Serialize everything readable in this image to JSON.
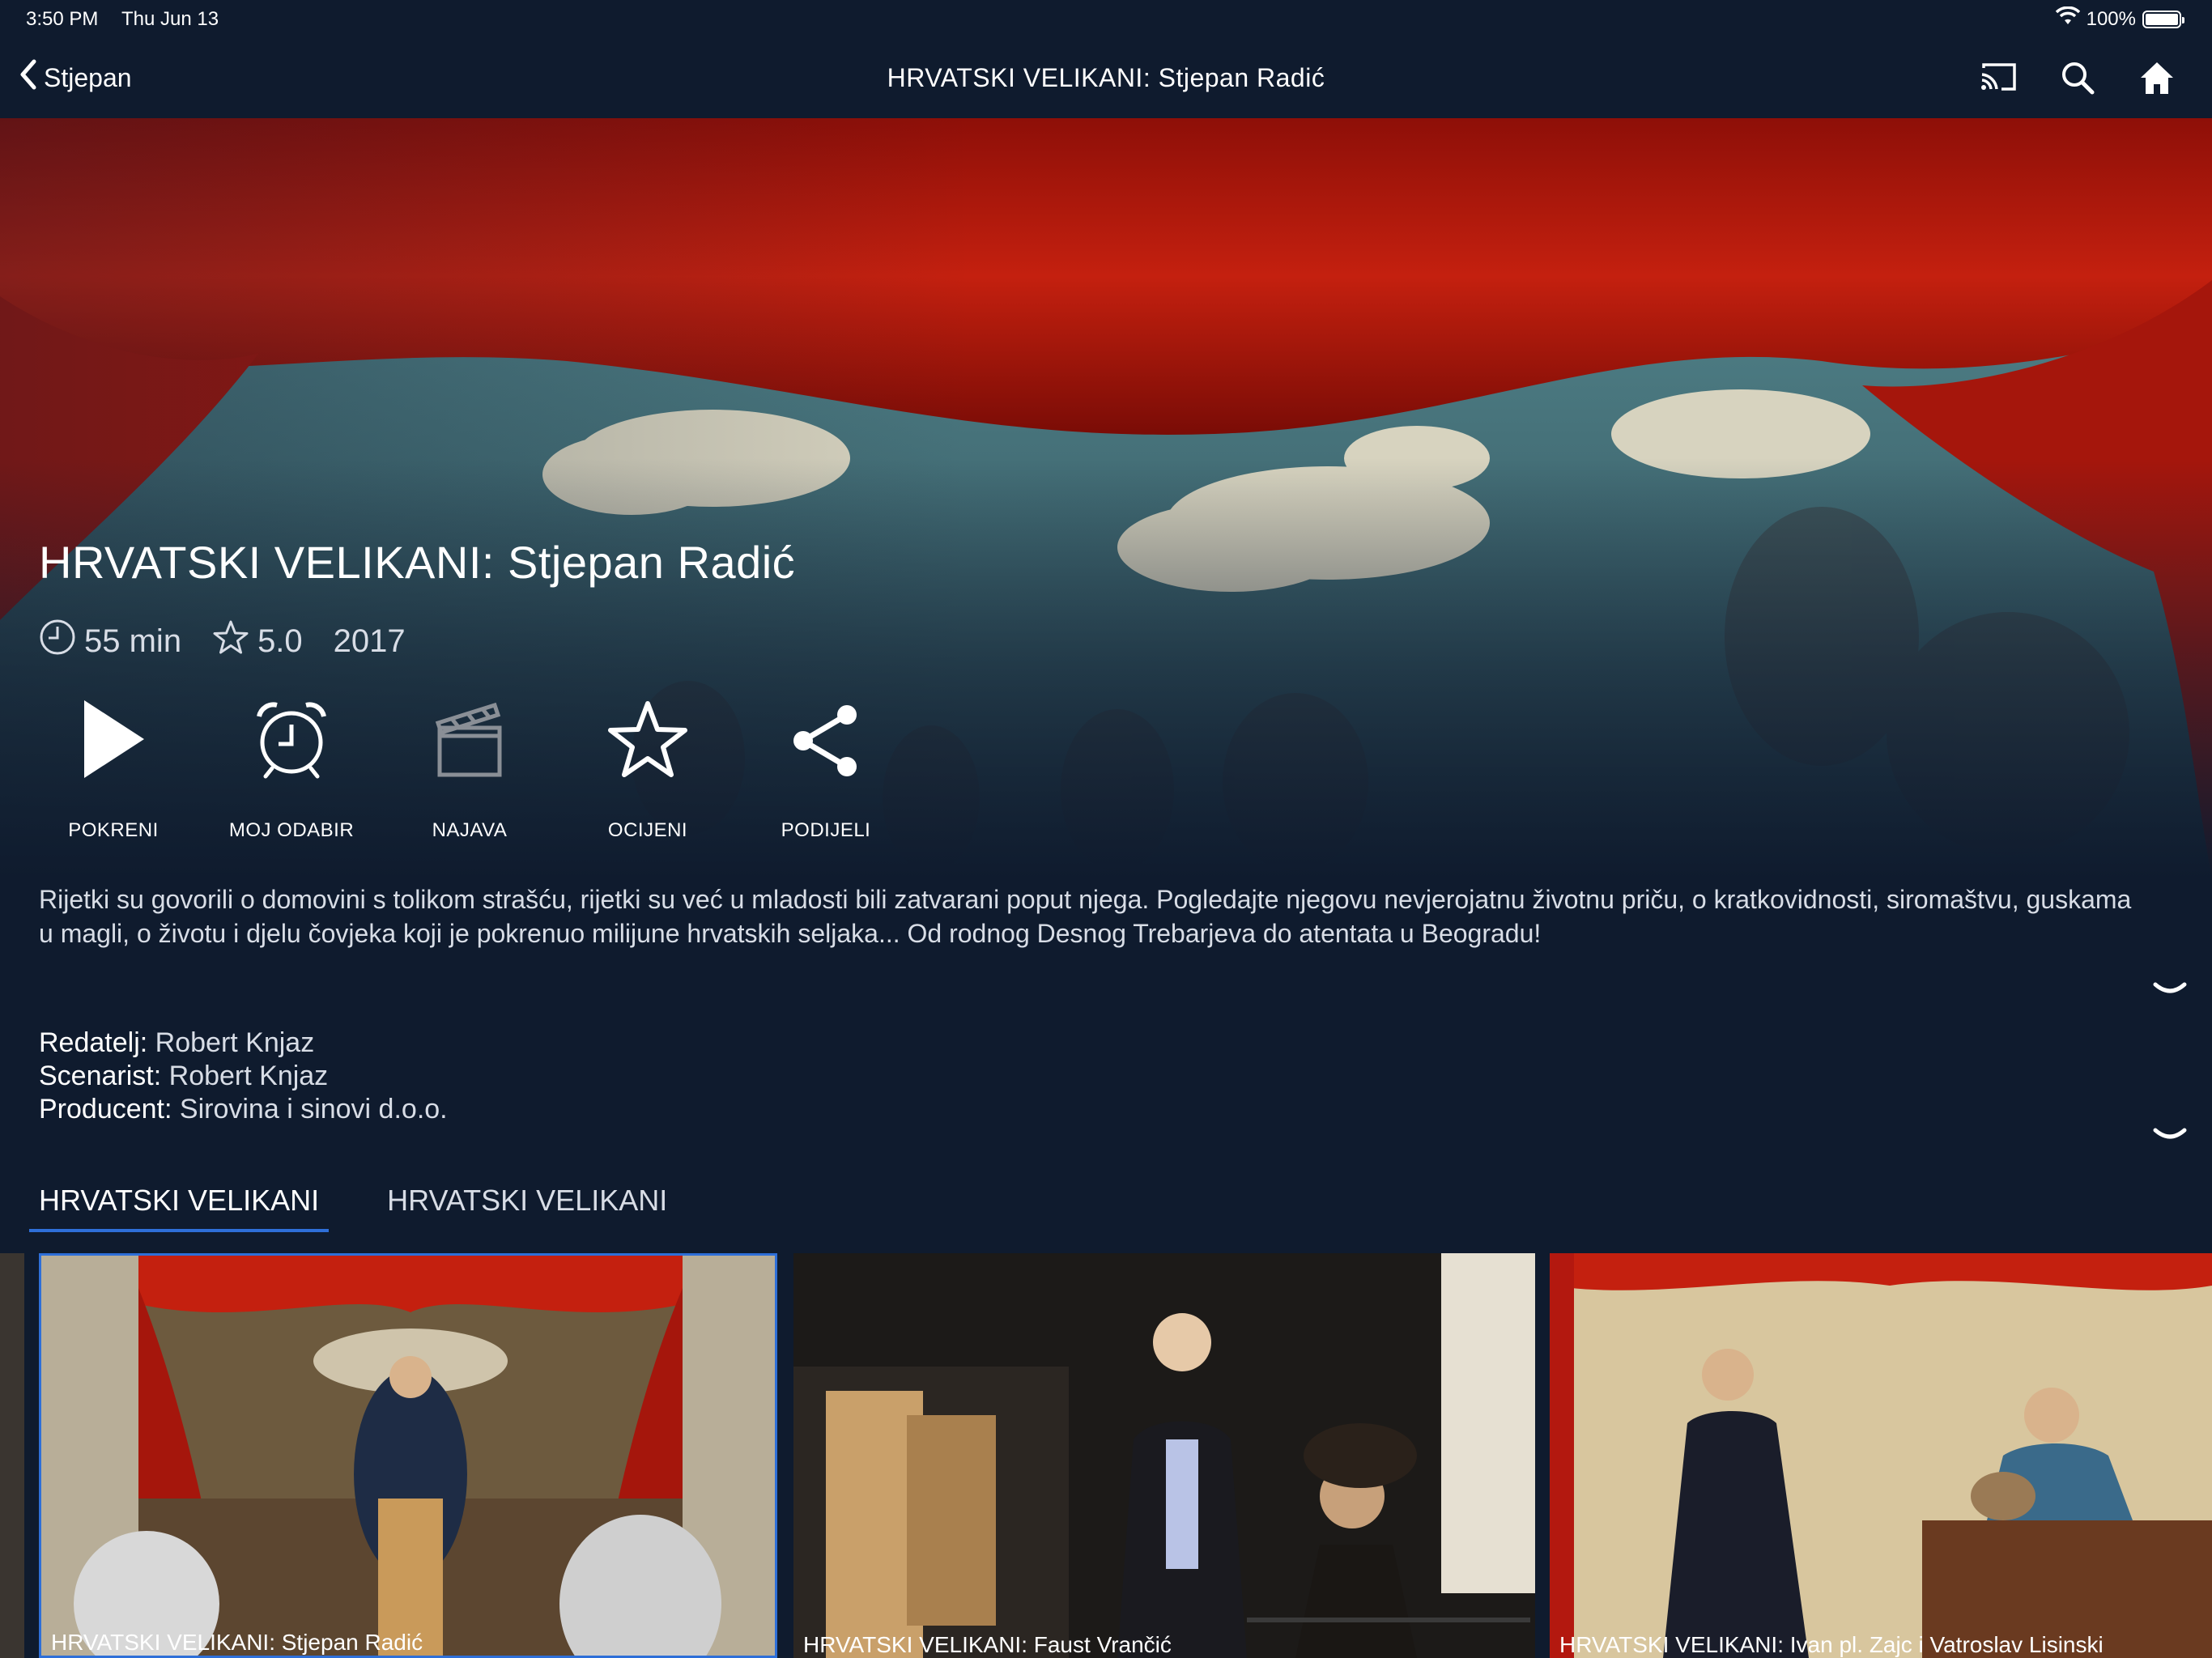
{
  "status_bar": {
    "time": "3:50 PM",
    "date": "Thu Jun 13",
    "battery": "100%"
  },
  "nav": {
    "back_label": "Stjepan",
    "title": "HRVATSKI VELIKANI: Stjepan Radić"
  },
  "show": {
    "title": "HRVATSKI VELIKANI: Stjepan Radić",
    "duration": "55 min",
    "rating": "5.0",
    "year": "2017"
  },
  "actions": [
    {
      "label": "POKRENI",
      "icon": "play-icon"
    },
    {
      "label": "MOJ ODABIR",
      "icon": "alarm-clock-icon"
    },
    {
      "label": "NAJAVA",
      "icon": "clapperboard-icon"
    },
    {
      "label": "OCIJENI",
      "icon": "star-icon"
    },
    {
      "label": "PODIJELI",
      "icon": "share-icon"
    }
  ],
  "description": "Rijetki su govorili o domovini s tolikom strašću, rijetki su već u mladosti bili zatvarani poput njega. Pogledajte njegovu nevjerojatnu životnu priču, o kratkovidnosti, siromaštvu, guskama u magli, o životu i djelu čovjeka koji je pokrenuo milijune hrvatskih seljaka... Od rodnog Desnog Trebarjeva do atentata u Beogradu!",
  "credits": [
    {
      "key": "Redatelj:",
      "value": "Robert Knjaz"
    },
    {
      "key": "Scenarist:",
      "value": "Robert Knjaz"
    },
    {
      "key": "Producent:",
      "value": "Sirovina i sinovi d.o.o."
    }
  ],
  "tabs": [
    {
      "label": "HRVATSKI VELIKANI"
    },
    {
      "label": "HRVATSKI VELIKANI"
    }
  ],
  "episodes": [
    {
      "caption": "HRVATSKI VELIKANI: Stjepan Radić"
    },
    {
      "caption": "HRVATSKI VELIKANI: Faust Vrančić"
    },
    {
      "caption": "HRVATSKI VELIKANI: Ivan pl. Zajc i Vatroslav Lisinski"
    }
  ],
  "colors": {
    "background": "#0f1b2e",
    "accent": "#2e6fd8",
    "curtain": "#b3180f"
  }
}
